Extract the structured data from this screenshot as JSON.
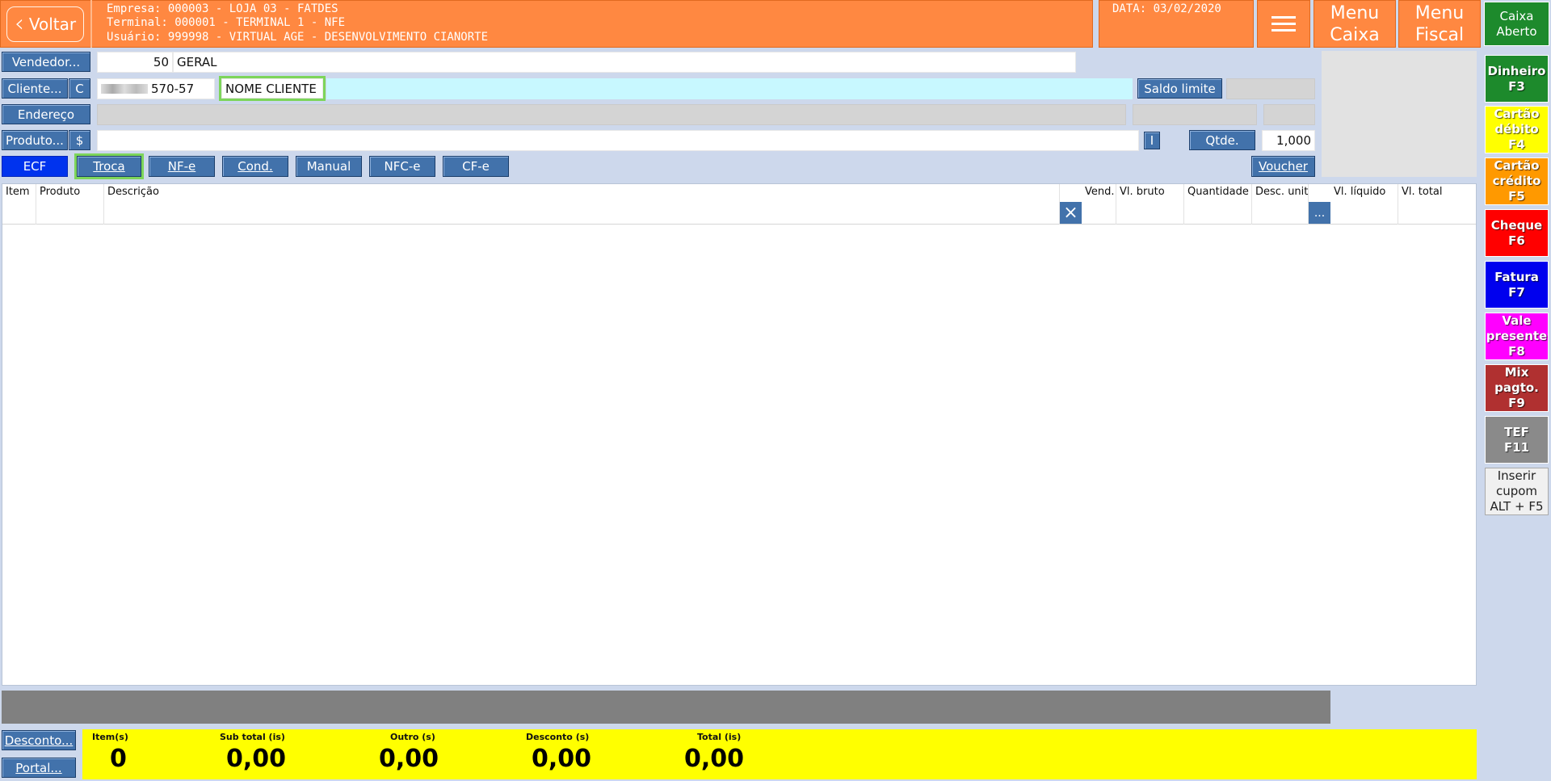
{
  "header": {
    "back_label": "Voltar",
    "empresa": "Empresa: 000003 - LOJA 03 - FATDES",
    "terminal": "Terminal: 000001 - TERMINAL 1 - NFE",
    "usuario": "Usuário: 999998 - VIRTUAL AGE - DESENVOLVIMENTO CIANORTE",
    "date": "DATA: 03/02/2020",
    "menu_caixa": [
      "Menu",
      "Caixa"
    ],
    "menu_fiscal": [
      "Menu",
      "Fiscal"
    ],
    "caixa_status": [
      "Caixa",
      "Aberto"
    ]
  },
  "form": {
    "vendedor_label": "Vendedor...",
    "vendedor_code": "50",
    "vendedor_name": "GERAL",
    "cliente_label": "Cliente...",
    "cliente_type": "C",
    "cliente_doc": "570-57",
    "cliente_name": "NOME CLIENTE",
    "saldo_limite_label": "Saldo limite",
    "endereco_label": "Endereço",
    "produto_label": "Produto...",
    "price_btn_label": "$",
    "info_btn_label": "I",
    "qtde_label": "Qtde.",
    "qtde_value": "1,000"
  },
  "modes": {
    "ecf": "ECF",
    "troca": "Troca",
    "nfe": "NF-e",
    "cond": "Cond.",
    "manual": "Manual",
    "nfce": "NFC-e",
    "cfe": "CF-e",
    "voucher": "Voucher"
  },
  "table": {
    "columns": [
      "Item",
      "Produto",
      "Descrição",
      "Vend.",
      "Vl. bruto",
      "Quantidade",
      "Desc. unit",
      "Vl. líquido",
      "Vl. total"
    ],
    "clear_icon": "close-icon",
    "ellipsis": "..."
  },
  "bottom": {
    "desconto_label": "Desconto...",
    "portal_label": "Portal...",
    "itens_label": "Item(s)",
    "itens_value": "0",
    "subtotal_label": "Sub total (is)",
    "subtotal_value": "0,00",
    "outro_label": "Outro (s)",
    "outro_value": "0,00",
    "desconto_tot_label": "Desconto (s)",
    "desconto_tot_value": "0,00",
    "total_label": "Total (is)",
    "total_value": "0,00"
  },
  "payments": {
    "dinheiro": [
      "Dinheiro",
      "F3"
    ],
    "debito": [
      "Cartão",
      "débito",
      "F4"
    ],
    "credito": [
      "Cartão",
      "crédito",
      "F5"
    ],
    "cheque": [
      "Cheque",
      "F6"
    ],
    "fatura": [
      "Fatura",
      "F7"
    ],
    "vale": [
      "Vale",
      "presente",
      "F8"
    ],
    "mix": [
      "Mix",
      "pagto.",
      "F9"
    ],
    "tef": [
      "TEF",
      "F11"
    ],
    "inserir": [
      "Inserir",
      "cupom",
      "ALT + F5"
    ]
  },
  "colors": {
    "header_orange": "#ff8841",
    "button_blue": "#4272ab",
    "totals_yellow": "#ffff00",
    "ecf_active": "#0033ee",
    "dinheiro": "#1d8a2c",
    "debito": "#ffff00",
    "credito": "#ff9900",
    "cheque": "#ff0000",
    "fatura": "#0000ee",
    "vale": "#ff00ff",
    "mix": "#b03030",
    "tef": "#8a8a8a",
    "inserir": "#f0f0f0"
  }
}
